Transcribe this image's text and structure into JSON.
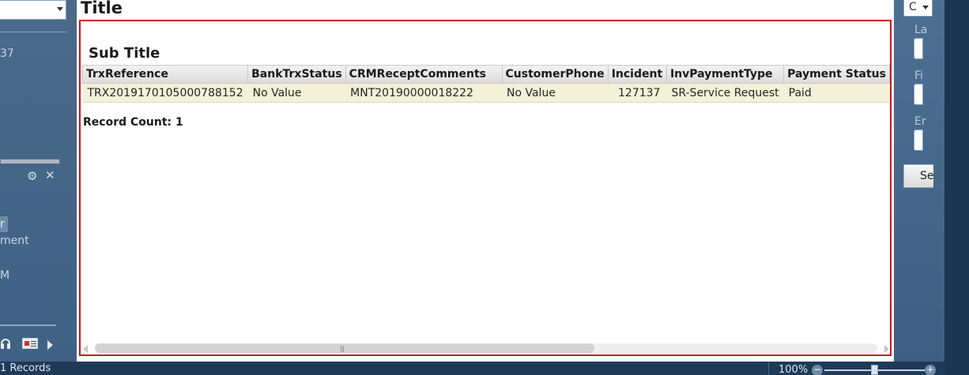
{
  "header": {
    "title": "Title"
  },
  "report": {
    "subtitle": "Sub Title",
    "columns": [
      "TrxReference",
      "BankTrxStatus",
      "CRMReceptComments",
      "CustomerPhone",
      "Incident",
      "InvPaymentType",
      "Payment Status"
    ],
    "rows": [
      [
        "TRX2019170105000788152",
        "No Value",
        "MNT20190000018222",
        "No Value",
        "127137",
        "SR-Service Request",
        "Paid"
      ]
    ],
    "record_count": "Record Count: 1"
  },
  "left_panel": {
    "fragment_37": "37",
    "nav_selected": "r",
    "nav_item_ment": "ment",
    "nav_item_m": "M",
    "icons": [
      "gear-icon",
      "close-icon",
      "headset-icon",
      "contact-card-icon",
      "arrow-right-icon"
    ]
  },
  "right_panel": {
    "dropdown_value": "C",
    "labels": [
      "La",
      "Fi",
      "Er"
    ],
    "button_label": "Se"
  },
  "status_bar": {
    "records": "1 Records",
    "zoom": "100%",
    "zoom_minus": "−",
    "zoom_plus": "+",
    "zoom_level": 0.5
  },
  "colors": {
    "frame_border": "#d0101a",
    "row_highlight": "#f3f1d7",
    "panel_blue": "#3f5f80"
  }
}
